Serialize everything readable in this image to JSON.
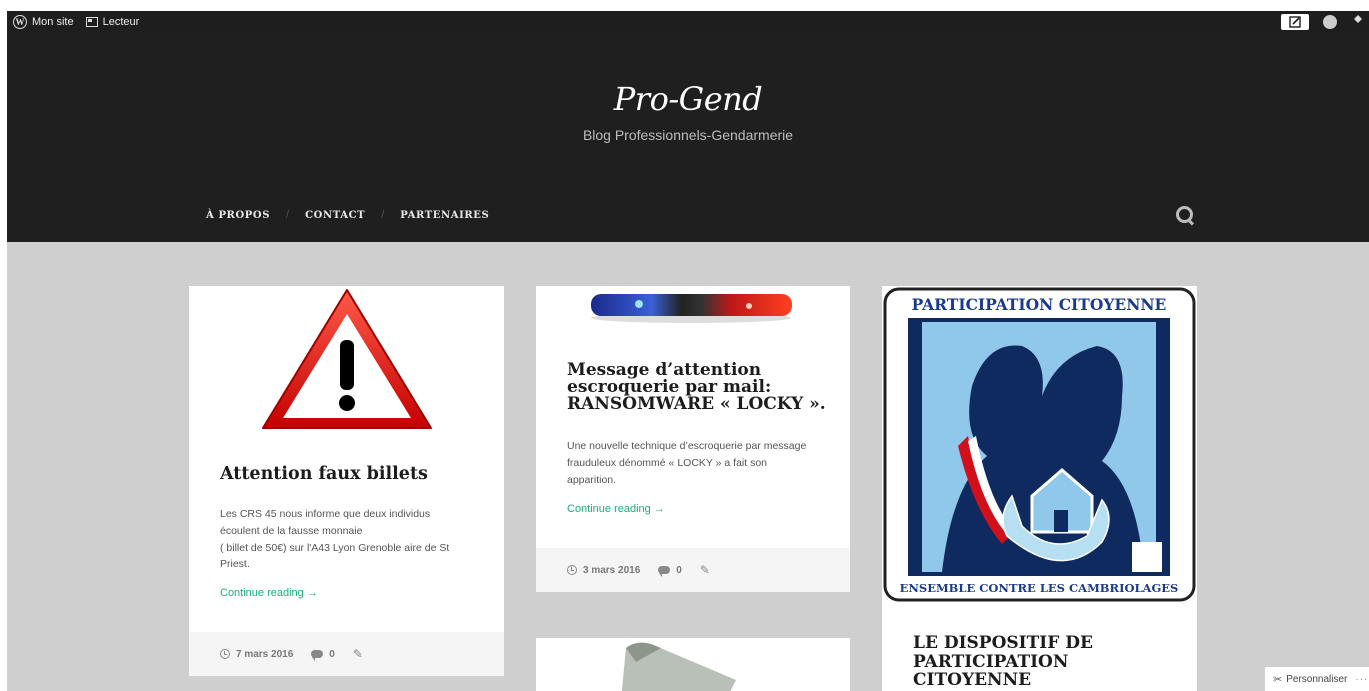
{
  "admin_bar": {
    "my_site": "Mon site",
    "reader": "Lecteur"
  },
  "header": {
    "site_title": "Pro-Gend",
    "site_description": "Blog Professionnels-Gendarmerie"
  },
  "nav": {
    "items": [
      {
        "label": "À PROPOS"
      },
      {
        "label": "CONTACT"
      },
      {
        "label": "PARTENAIRES"
      }
    ],
    "separator": "/"
  },
  "posts": [
    {
      "title": "Attention faux billets",
      "excerpt_lines": [
        "Les CRS 45 nous informe que deux individus",
        "écoulent de la fausse monnaie",
        "( billet de 50€) sur l'A43 Lyon Grenoble aire de St",
        "Priest."
      ],
      "continue": "Continue reading →",
      "date": "7 mars 2016",
      "comments": "0"
    },
    {
      "title_lines": [
        "Message d’attention",
        "escroquerie par mail:",
        "RANSOMWARE « LOCKY »."
      ],
      "excerpt_lines": [
        "Une nouvelle technique d’escroquerie par message",
        "frauduleux dénommé « LOCKY » a fait son",
        "apparition."
      ],
      "continue": "Continue reading →",
      "date": "3 mars 2016",
      "comments": "0"
    },
    {
      "poster_top": "PARTICIPATION CITOYENNE",
      "poster_bottom": "ENSEMBLE CONTRE LES CAMBRIOLAGES",
      "title_lines": [
        "LE DISPOSITIF DE",
        "PARTICIPATION",
        "CITOYENNE"
      ]
    }
  ],
  "customize": {
    "label": "Personnaliser",
    "dots": "···"
  },
  "colors": {
    "header_bg": "#1f1f1f",
    "admin_bg": "#1e1e1e",
    "page_bg": "#cfcfcf",
    "link": "#1bb079"
  }
}
